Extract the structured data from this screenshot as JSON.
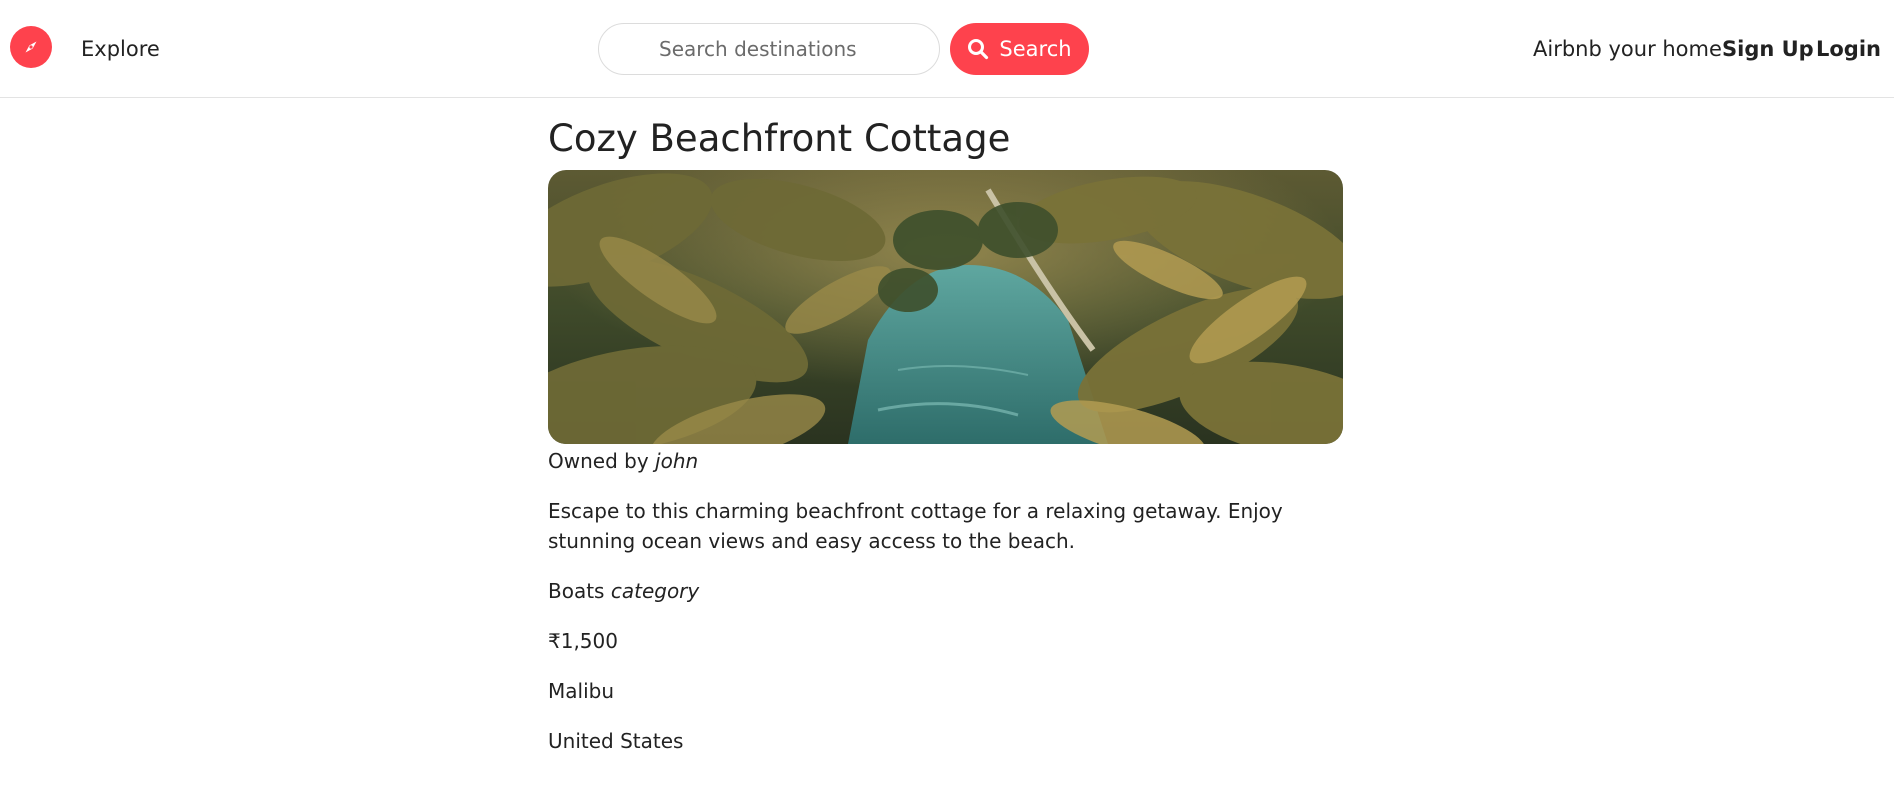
{
  "brand": {
    "logo_icon": "compass-icon",
    "color": "#fe424d"
  },
  "nav": {
    "explore": "Explore",
    "airbnb_home": "Airbnb your home",
    "signup": "Sign Up",
    "login": "Login"
  },
  "search": {
    "placeholder": "Search destinations",
    "button_label": "Search",
    "icon": "search-icon"
  },
  "listing": {
    "title": "Cozy Beachfront Cottage",
    "image_alt": "Tropical lagoon with palm trees",
    "owned_by_prefix": "Owned by",
    "owner": "john",
    "description": "Escape to this charming beachfront cottage for a relaxing getaway. Enjoy stunning ocean views and easy access to the beach.",
    "category_name": "Boats",
    "category_suffix": "category",
    "price": "₹1,500",
    "location": "Malibu",
    "country": "United States"
  }
}
